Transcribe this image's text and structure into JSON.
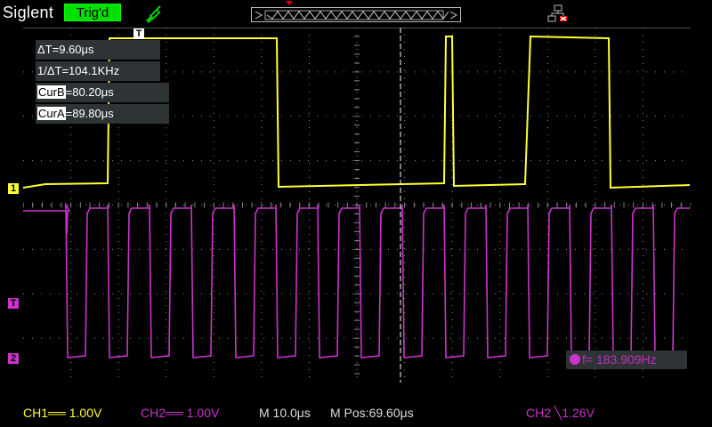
{
  "header": {
    "brand": "Siglent",
    "trigger_status": "Trig'd",
    "probe_icon": "probe-icon",
    "network_icon": "network-disconnected-icon"
  },
  "measurements": {
    "delta_t": "ΔT=9.60μs",
    "inv_delta_t": "1/ΔT=104.1KHz",
    "cur_b_label": "CurB",
    "cur_b_value": "=80.20μs",
    "cur_a_label": "CurA",
    "cur_a_value": "=89.80μs",
    "frequency": "f= 183.909Hz"
  },
  "markers": {
    "trigger_time": "T",
    "ch1_level": "1",
    "trigger_level": "T",
    "ch2_level": "2"
  },
  "status_bar": {
    "ch1": "CH1══ 1.00V",
    "ch2": "CH2══ 1.00V",
    "timebase": "M 10.0μs",
    "position": "M Pos:69.60μs",
    "trigger": "CH2 ╲1.26V"
  },
  "colors": {
    "ch1": "#ffff33",
    "ch2": "#cc33cc",
    "grid": "#8a8a8a",
    "trigger_green": "#00e000"
  },
  "chart_data": {
    "type": "line",
    "series": [
      {
        "name": "CH1",
        "points": [
          [
            0,
            180
          ],
          [
            25,
            176
          ],
          [
            95,
            175
          ],
          [
            97,
            12
          ],
          [
            285,
            12
          ],
          [
            287,
            179
          ],
          [
            473,
            175
          ],
          [
            475,
            10
          ],
          [
            482,
            10
          ],
          [
            484,
            178
          ],
          [
            564,
            176
          ],
          [
            570,
            10
          ],
          [
            658,
            12
          ],
          [
            660,
            180
          ],
          [
            749,
            177
          ]
        ]
      },
      {
        "name": "CH2",
        "points": [
          [
            0,
            206
          ],
          [
            48,
            206
          ],
          [
            49,
            232
          ],
          [
            50,
            206
          ],
          [
            52,
            206
          ]
        ]
      }
    ],
    "ch2_pulse_starts": [
      48,
      95,
      142,
      189,
      237,
      284,
      331,
      378,
      426,
      473,
      520,
      567,
      614,
      661,
      708
    ],
    "ch2_period": 47,
    "ch2_high_width": 24,
    "ch2_high_level": 203,
    "ch2_low_level": 371,
    "cursor_x": 424
  }
}
